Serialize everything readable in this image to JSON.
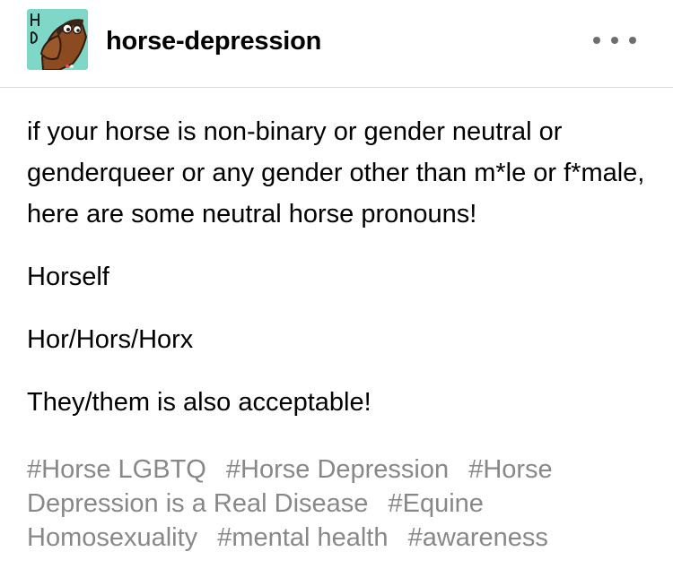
{
  "header": {
    "blog_name": "horse-depression",
    "avatar_letters": "H D",
    "more_icon": "more-horizontal-icon"
  },
  "post": {
    "intro": "if your horse is non-binary or gender neutral or genderqueer or any gender other than m*le or f*male, here are some neutral horse pronouns!",
    "lines": [
      "Horself",
      "Hor/Hors/Horx",
      "They/them is also acceptable!"
    ]
  },
  "tags": [
    "#Horse LGBTQ",
    "#Horse Depression",
    "#Horse Depression is a Real Disease",
    "#Equine Homosexuality",
    "#mental health",
    "#awareness"
  ],
  "colors": {
    "avatar_bg": "#7fd7c8",
    "tag_gray": "#888888",
    "divider": "#d9d9d9"
  }
}
